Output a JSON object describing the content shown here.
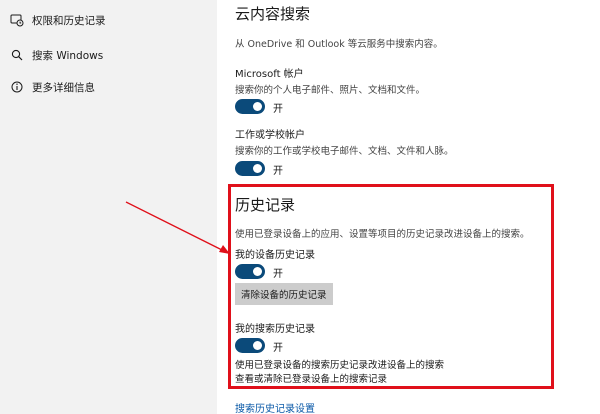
{
  "sidebar": {
    "items": [
      {
        "label": "权限和历史记录",
        "icon": "permissions-history-icon"
      },
      {
        "label": "搜索 Windows",
        "icon": "search-icon"
      },
      {
        "label": "更多详细信息",
        "icon": "info-icon"
      }
    ]
  },
  "cloud": {
    "title": "云内容搜索",
    "description": "从 OneDrive 和 Outlook 等云服务中搜索内容。",
    "microsoft": {
      "label": "Microsoft 帐户",
      "description": "搜索你的个人电子邮件、照片、文档和文件。",
      "toggle_text": "开"
    },
    "work": {
      "label": "工作或学校帐户",
      "description": "搜索你的工作或学校电子邮件、文档、文件和人脉。",
      "toggle_text": "开"
    }
  },
  "history": {
    "title": "历史记录",
    "description": "使用已登录设备上的应用、设置等项目的历史记录改进设备上的搜索。",
    "device": {
      "label": "我的设备历史记录",
      "toggle_text": "开",
      "clear_button": "清除设备的历史记录"
    },
    "search": {
      "label": "我的搜索历史记录",
      "toggle_text": "开",
      "line1": "使用已登录设备的搜索历史记录改进设备上的搜索",
      "line2": "查看或清除已登录设备上的搜索记录"
    },
    "settings_link": "搜索历史记录设置"
  },
  "colors": {
    "sidebar_bg": "#f2f2f2",
    "toggle_on": "#0b4a7a",
    "highlight_border": "#e0101a",
    "link": "#0b5aa8"
  }
}
